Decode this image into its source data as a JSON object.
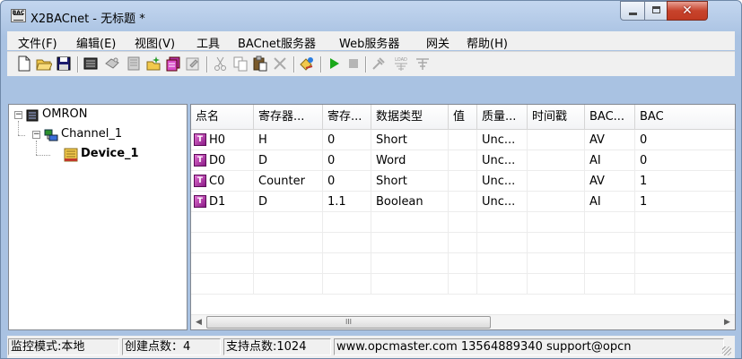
{
  "window": {
    "title": "X2BACnet - 无标题 *",
    "app_icon_text": "BAC"
  },
  "menu": [
    {
      "label": "文件(F)"
    },
    {
      "label": "编辑(E)"
    },
    {
      "label": "视图(V)"
    },
    {
      "label": "工具"
    },
    {
      "label": "BACnet服务器"
    },
    {
      "label": "Web服务器"
    },
    {
      "label": "网关"
    },
    {
      "label": "帮助(H)"
    }
  ],
  "toolbar": {
    "icons": [
      "new-file-icon",
      "open-folder-icon",
      "save-icon",
      "add-channel-icon",
      "add-device-icon",
      "add-group-icon",
      "add-tag-icon",
      "add-multiple-tags-icon",
      "properties-icon",
      "cut-icon",
      "copy-icon",
      "paste-icon",
      "delete-icon",
      "quick-client-icon",
      "run-icon",
      "stop-icon",
      "tools-icon",
      "load-icon",
      "save-project-icon"
    ],
    "load_text": "LOAD"
  },
  "tree": {
    "root": {
      "label": "OMRON",
      "expander": "−"
    },
    "channel": {
      "label": "Channel_1",
      "expander": "−"
    },
    "device": {
      "label": "Device_1"
    }
  },
  "table": {
    "columns": [
      "点名",
      "寄存器...",
      "寄存...",
      "数据类型",
      "值",
      "质量...",
      "时间戳",
      "BAC...",
      "BAC"
    ],
    "rows": [
      {
        "name": "H0",
        "register": "H",
        "address": "0",
        "type": "Short",
        "value": "",
        "quality": "Unc...",
        "timestamp": "",
        "bac_type": "AV",
        "bac_index": "0"
      },
      {
        "name": "D0",
        "register": "D",
        "address": "0",
        "type": "Word",
        "value": "",
        "quality": "Unc...",
        "timestamp": "",
        "bac_type": "AI",
        "bac_index": "0"
      },
      {
        "name": "C0",
        "register": "Counter",
        "address": "0",
        "type": "Short",
        "value": "",
        "quality": "Unc...",
        "timestamp": "",
        "bac_type": "AV",
        "bac_index": "1"
      },
      {
        "name": "D1",
        "register": "D",
        "address": "1.1",
        "type": "Boolean",
        "value": "",
        "quality": "Unc...",
        "timestamp": "",
        "bac_type": "AI",
        "bac_index": "1"
      }
    ],
    "scroll_left": "◀",
    "scroll_right": "▶",
    "scroll_thumb": "III"
  },
  "status": {
    "mode": "监控模式:本地",
    "created": "创建点数：4",
    "supported": "支持点数:1024",
    "contact": "www.opcmaster.com 13564889340 support@opcn"
  },
  "colors": {
    "title_gradient_top": "#c3d6ef",
    "close_button": "#c7432c",
    "tag_icon": "#8a1a86",
    "run_green": "#1aa81a"
  }
}
